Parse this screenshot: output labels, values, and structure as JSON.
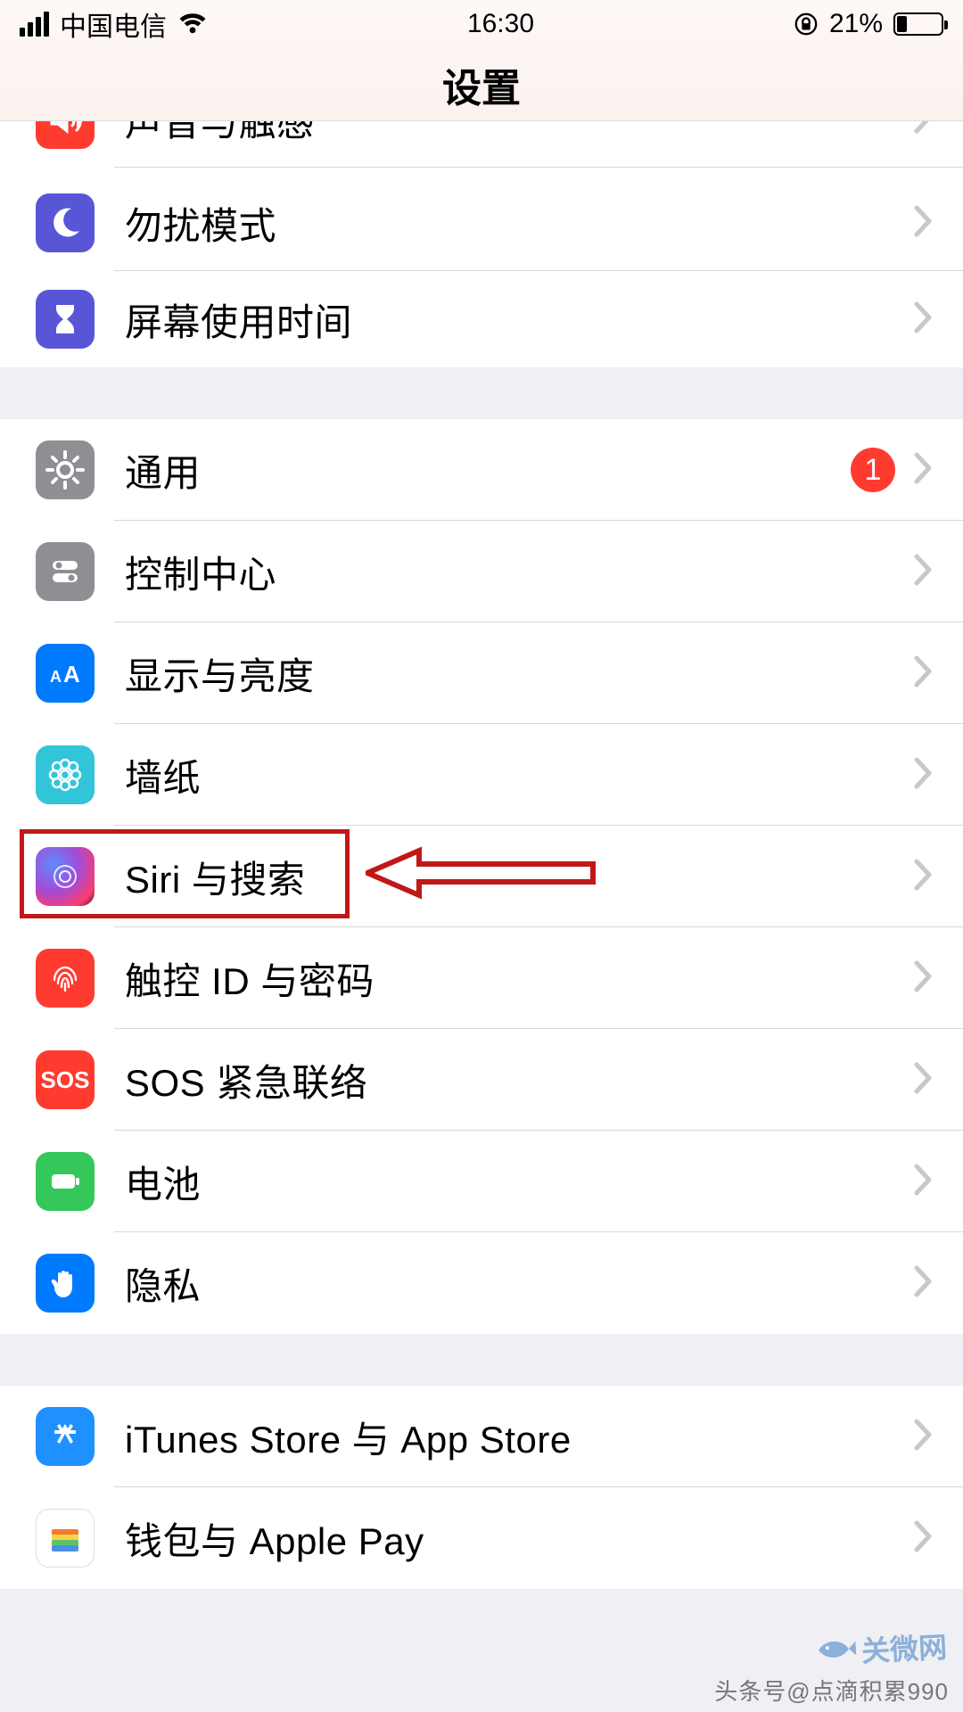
{
  "statusbar": {
    "carrier": "中国电信",
    "time": "16:30",
    "battery_pct": "21%"
  },
  "nav": {
    "title": "设置"
  },
  "group1": {
    "sounds": {
      "label": "声音与触感"
    },
    "dnd": {
      "label": "勿扰模式"
    },
    "screen": {
      "label": "屏幕使用时间"
    }
  },
  "group2": {
    "general": {
      "label": "通用",
      "badge": "1"
    },
    "control": {
      "label": "控制中心"
    },
    "display": {
      "label": "显示与亮度"
    },
    "wallpaper": {
      "label": "墙纸"
    },
    "siri": {
      "label": "Siri 与搜索"
    },
    "touchid": {
      "label": "触控 ID 与密码"
    },
    "sos": {
      "label": "SOS 紧急联络",
      "icon_text": "SOS"
    },
    "battery": {
      "label": "电池"
    },
    "privacy": {
      "label": "隐私"
    }
  },
  "group3": {
    "store": {
      "label": "iTunes Store 与 App Store"
    },
    "wallet": {
      "label": "钱包与 Apple Pay"
    }
  },
  "watermark": {
    "line1": "关微网",
    "line2": "头条号@点滴积累990"
  }
}
